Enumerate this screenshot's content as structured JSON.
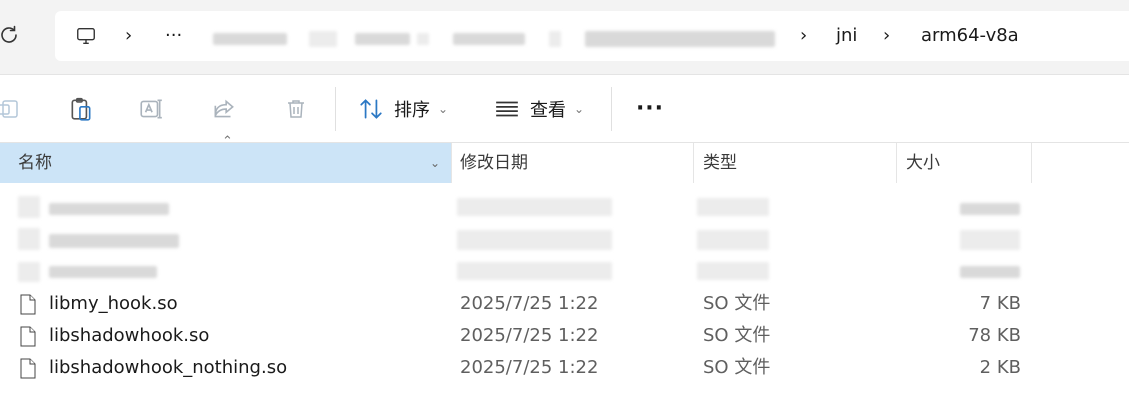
{
  "address_bar": {
    "overflow_label": "···",
    "breadcrumbs": [
      {
        "label": "jni"
      },
      {
        "label": "arm64-v8a"
      }
    ]
  },
  "toolbar": {
    "sort_label": "排序",
    "view_label": "查看",
    "more_label": "···"
  },
  "columns": {
    "name": "名称",
    "date": "修改日期",
    "type": "类型",
    "size": "大小"
  },
  "files": [
    {
      "name": "libmy_hook.so",
      "date": "2025/7/25 1:22",
      "type": "SO 文件",
      "size": "7 KB"
    },
    {
      "name": "libshadowhook.so",
      "date": "2025/7/25 1:22",
      "type": "SO 文件",
      "size": "78 KB"
    },
    {
      "name": "libshadowhook_nothing.so",
      "date": "2025/7/25 1:22",
      "type": "SO 文件",
      "size": "2 KB"
    }
  ],
  "colors": {
    "selected_header": "#cce4f7",
    "topbar_bg": "#f3f3f3",
    "secondary_text": "#5f5f5f"
  },
  "icons": [
    "refresh-icon",
    "computer-icon",
    "chevron-right-icon",
    "new-folder-icon",
    "paste-icon",
    "rename-icon",
    "share-icon",
    "delete-icon",
    "sort-icon",
    "view-icon",
    "file-icon"
  ]
}
